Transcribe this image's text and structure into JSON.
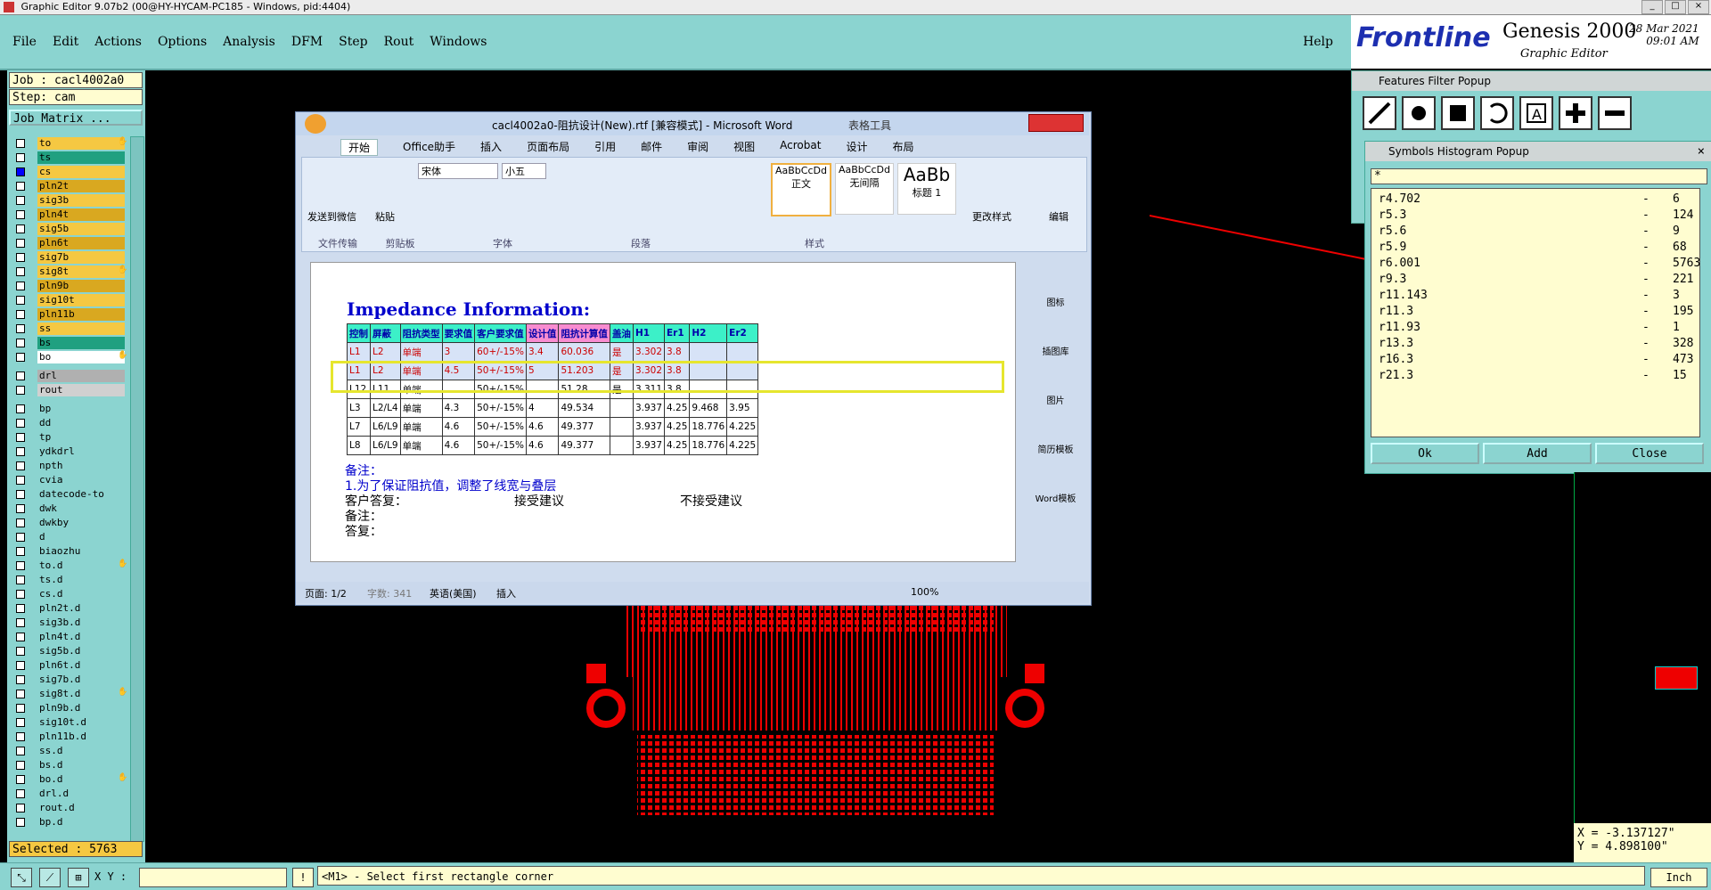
{
  "window": {
    "title": "Graphic Editor 9.07b2 (00@HY-HYCAM-PC185 - Windows, pid:4404)"
  },
  "menu": {
    "items": [
      "File",
      "Edit",
      "Actions",
      "Options",
      "Analysis",
      "DFM",
      "Step",
      "Rout",
      "Windows"
    ],
    "help": "Help"
  },
  "brand": {
    "logo": "Frontline",
    "product": "Genesis 2000",
    "subtitle": "Graphic Editor",
    "date": "28 Mar 2021",
    "time": "09:01 AM"
  },
  "job": {
    "job_label": "Job : cacl4002a0",
    "step_label": "Step: cam",
    "matrix_button": "Job Matrix ..."
  },
  "layers": [
    {
      "name": "to",
      "color": "#f5c842",
      "hand": true
    },
    {
      "name": "ts",
      "color": "#20a080"
    },
    {
      "name": "cs",
      "color": "#f5c842",
      "active": true
    },
    {
      "name": "pln2t",
      "color": "#d9a820"
    },
    {
      "name": "sig3b",
      "color": "#f5c842"
    },
    {
      "name": "pln4t",
      "color": "#d9a820"
    },
    {
      "name": "sig5b",
      "color": "#f5c842"
    },
    {
      "name": "pln6t",
      "color": "#d9a820"
    },
    {
      "name": "sig7b",
      "color": "#f5c842"
    },
    {
      "name": "sig8t",
      "color": "#f5c842",
      "hand": true
    },
    {
      "name": "pln9b",
      "color": "#d9a820"
    },
    {
      "name": "sig10t",
      "color": "#f5c842"
    },
    {
      "name": "pln11b",
      "color": "#d9a820"
    },
    {
      "name": "ss",
      "color": "#f5c842"
    },
    {
      "name": "bs",
      "color": "#20a080"
    },
    {
      "name": "bo",
      "color": "#fff",
      "hand": true
    },
    {
      "name": "drl",
      "color": "#b0b0b0",
      "gap": true
    },
    {
      "name": "rout",
      "color": "#d0d0d0"
    },
    {
      "name": "bp",
      "color": "#8bd4d0",
      "gap": true
    },
    {
      "name": "dd",
      "color": "#8bd4d0"
    },
    {
      "name": "tp",
      "color": "#8bd4d0"
    },
    {
      "name": "ydkdrl",
      "color": "#8bd4d0"
    },
    {
      "name": "npth",
      "color": "#8bd4d0"
    },
    {
      "name": "cvia",
      "color": "#8bd4d0"
    },
    {
      "name": "datecode-to",
      "color": "#8bd4d0"
    },
    {
      "name": "dwk",
      "color": "#8bd4d0"
    },
    {
      "name": "dwkby",
      "color": "#8bd4d0"
    },
    {
      "name": "d",
      "color": "#8bd4d0"
    },
    {
      "name": "biaozhu",
      "color": "#8bd4d0"
    },
    {
      "name": "to.d",
      "color": "#8bd4d0",
      "hand": true
    },
    {
      "name": "ts.d",
      "color": "#8bd4d0"
    },
    {
      "name": "cs.d",
      "color": "#8bd4d0"
    },
    {
      "name": "pln2t.d",
      "color": "#8bd4d0"
    },
    {
      "name": "sig3b.d",
      "color": "#8bd4d0"
    },
    {
      "name": "pln4t.d",
      "color": "#8bd4d0"
    },
    {
      "name": "sig5b.d",
      "color": "#8bd4d0"
    },
    {
      "name": "pln6t.d",
      "color": "#8bd4d0"
    },
    {
      "name": "sig7b.d",
      "color": "#8bd4d0"
    },
    {
      "name": "sig8t.d",
      "color": "#8bd4d0",
      "hand": true
    },
    {
      "name": "pln9b.d",
      "color": "#8bd4d0"
    },
    {
      "name": "sig10t.d",
      "color": "#8bd4d0"
    },
    {
      "name": "pln11b.d",
      "color": "#8bd4d0"
    },
    {
      "name": "ss.d",
      "color": "#8bd4d0"
    },
    {
      "name": "bs.d",
      "color": "#8bd4d0"
    },
    {
      "name": "bo.d",
      "color": "#8bd4d0",
      "hand": true
    },
    {
      "name": "drl.d",
      "color": "#8bd4d0"
    },
    {
      "name": "rout.d",
      "color": "#8bd4d0"
    },
    {
      "name": "bp.d",
      "color": "#8bd4d0"
    }
  ],
  "selected": "Selected : 5763",
  "bottom": {
    "xy_label": "X Y :",
    "xy_value": "",
    "message": "<M1> - Select first rectangle corner",
    "unit": "Inch"
  },
  "coords": {
    "x": "X = -3.137127\"",
    "y": "Y = 4.898100\""
  },
  "features_filter": {
    "title": "Features Filter Popup"
  },
  "symbols_histogram": {
    "title": "Symbols Histogram Popup",
    "filter": "*",
    "rows": [
      {
        "sym": "r4.702",
        "count": "6"
      },
      {
        "sym": "r5.3",
        "count": "124"
      },
      {
        "sym": "r5.6",
        "count": "9"
      },
      {
        "sym": "r5.9",
        "count": "68"
      },
      {
        "sym": "r6.001",
        "count": "5763"
      },
      {
        "sym": "r9.3",
        "count": "221"
      },
      {
        "sym": "r11.143",
        "count": "3"
      },
      {
        "sym": "r11.3",
        "count": "195"
      },
      {
        "sym": "r11.93",
        "count": "1"
      },
      {
        "sym": "r13.3",
        "count": "328"
      },
      {
        "sym": "r16.3",
        "count": "473"
      },
      {
        "sym": "r21.3",
        "count": "15"
      }
    ],
    "buttons": {
      "ok": "Ok",
      "add": "Add",
      "close": "Close"
    }
  },
  "word": {
    "title": "cacl4002a0-阻抗设计(New).rtf [兼容模式] - Microsoft Word",
    "tools": "表格工具",
    "tabs": [
      "开始",
      "Office助手",
      "插入",
      "页面布局",
      "引用",
      "邮件",
      "审阅",
      "视图",
      "Acrobat",
      "设计",
      "布局"
    ],
    "font": "宋体",
    "size": "小五",
    "groups": [
      "文件传输",
      "剪贴板",
      "字体",
      "段落",
      "样式"
    ],
    "styles": [
      "AaBbCcDd",
      "AaBbCcDd",
      "AaBb"
    ],
    "style_names": [
      "正文",
      "无间隔",
      "标题 1"
    ],
    "change_style": "更改样式",
    "edit": "编辑",
    "send": "发送到微信",
    "paste": "粘贴",
    "side": [
      "图标",
      "插图库",
      "图片",
      "简历模板",
      "Word模板"
    ],
    "doc_title": "Impedance Information:",
    "table": {
      "headers": [
        "控制",
        "屏蔽",
        "阻抗类型",
        "要求值",
        "客户要求值",
        "设计值",
        "阻抗计算值",
        "盖油",
        "H1",
        "Er1",
        "H2",
        "Er2"
      ],
      "rows": [
        [
          "L1",
          "L2",
          "单端",
          "3",
          "60+/-15%",
          "3.4",
          "60.036",
          "是",
          "3.302",
          "3.8",
          "",
          ""
        ],
        [
          "L1",
          "L2",
          "单端",
          "4.5",
          "50+/-15%",
          "5",
          "51.203",
          "是",
          "3.302",
          "3.8",
          "",
          ""
        ],
        [
          "L12",
          "L11",
          "单端",
          "",
          "50+/-15%",
          "",
          "51.28",
          "是",
          "3.311",
          "3.8",
          "",
          ""
        ],
        [
          "L3",
          "L2/L4",
          "单端",
          "4.3",
          "50+/-15%",
          "4",
          "49.534",
          "",
          "3.937",
          "4.25",
          "9.468",
          "3.95"
        ],
        [
          "L7",
          "L6/L9",
          "单端",
          "4.6",
          "50+/-15%",
          "4.6",
          "49.377",
          "",
          "3.937",
          "4.25",
          "18.776",
          "4.225"
        ],
        [
          "L8",
          "L6/L9",
          "单端",
          "4.6",
          "50+/-15%",
          "4.6",
          "49.377",
          "",
          "3.937",
          "4.25",
          "18.776",
          "4.225"
        ]
      ]
    },
    "notes": [
      "备注：",
      "1.为了保证阻抗值，调整了线宽与叠层",
      "客户答复：",
      "接受建议",
      "不接受建议",
      "备注：",
      "答复："
    ],
    "status": {
      "page": "页面: 1/2",
      "words": "字数: 341",
      "lang": "英语(美国)",
      "mode": "插入",
      "zoom": "100%"
    }
  }
}
